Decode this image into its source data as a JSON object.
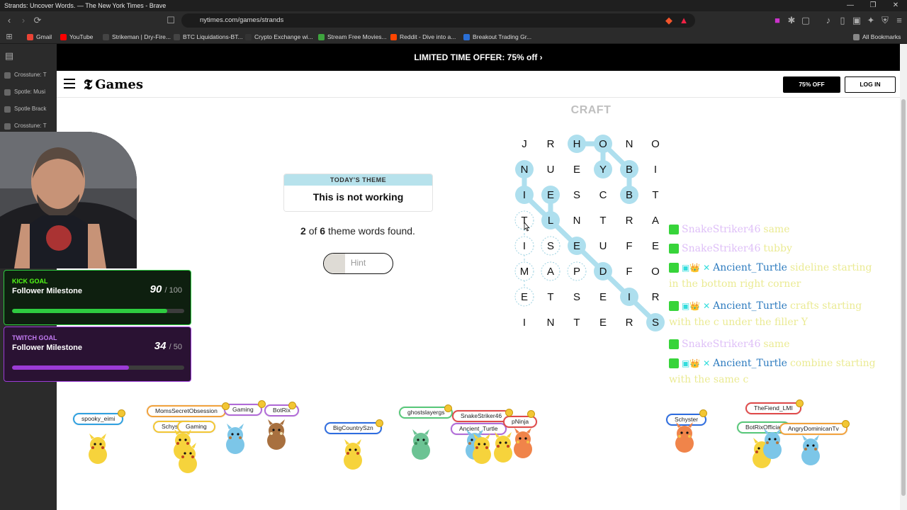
{
  "browser": {
    "window_title": "Strands: Uncover Words. — The New York Times - Brave",
    "url": "nytimes.com/games/strands",
    "bookmarks": [
      {
        "label": "Gmail",
        "color": "#ea4335"
      },
      {
        "label": "YouTube",
        "color": "#ff0000"
      },
      {
        "label": "Strikeman | Dry-Fire...",
        "color": "#444444"
      },
      {
        "label": "BTC Liquidations-BT...",
        "color": "#444444"
      },
      {
        "label": "Crypto Exchange wi...",
        "color": "#333333"
      },
      {
        "label": "Stream Free Movies...",
        "color": "#3ea43e"
      },
      {
        "label": "Reddit - Dive into a...",
        "color": "#ff4500"
      },
      {
        "label": "Breakout Trading Gr...",
        "color": "#2a6fd6"
      }
    ],
    "all_bookmarks": "All Bookmarks"
  },
  "sidebar": {
    "items": [
      "Crosstune: T",
      "Spotle: Musi",
      "Spotle Brack",
      "Crosstune: T"
    ]
  },
  "page": {
    "promo": "LIMITED TIME OFFER: 75% off ›",
    "logo": "Games",
    "offer_button": "75% OFF",
    "login_button": "LOG IN",
    "theme_label": "TODAY'S THEME",
    "theme_text": "This is not working",
    "progress": {
      "found": "2",
      "of_word": "of",
      "total": "6",
      "suffix": "theme words found."
    },
    "hint_label": "Hint",
    "found_word": "CRAFT"
  },
  "board": {
    "rows": [
      [
        "J",
        "R",
        "H",
        "O",
        "N",
        "O"
      ],
      [
        "N",
        "U",
        "E",
        "Y",
        "B",
        "I"
      ],
      [
        "I",
        "E",
        "S",
        "C",
        "B",
        "T"
      ],
      [
        "T",
        "L",
        "N",
        "T",
        "R",
        "A"
      ],
      [
        "I",
        "S",
        "E",
        "U",
        "F",
        "E"
      ],
      [
        "M",
        "A",
        "P",
        "D",
        "F",
        "O"
      ],
      [
        "E",
        "T",
        "S",
        "E",
        "I",
        "R"
      ],
      [
        "I",
        "N",
        "T",
        "E",
        "R",
        "S"
      ]
    ],
    "highlight_color": "#aedfee",
    "highlighted": [
      [
        0,
        2
      ],
      [
        0,
        3
      ],
      [
        1,
        0
      ],
      [
        1,
        3
      ],
      [
        1,
        4
      ],
      [
        2,
        0
      ],
      [
        2,
        1
      ],
      [
        2,
        4
      ],
      [
        3,
        1
      ],
      [
        4,
        2
      ],
      [
        5,
        3
      ],
      [
        6,
        4
      ],
      [
        7,
        5
      ]
    ],
    "dashed": [
      [
        3,
        0
      ],
      [
        4,
        0
      ],
      [
        4,
        1
      ],
      [
        5,
        0
      ],
      [
        5,
        1
      ],
      [
        5,
        2
      ],
      [
        6,
        0
      ]
    ]
  },
  "overlay": {
    "kick_goal": {
      "tag": "KICK GOAL",
      "name": "Follower Milestone",
      "current": "90",
      "target": "100",
      "fraction": 0.9,
      "color": "#2ecc40"
    },
    "twitch_goal": {
      "tag": "TWITCH GOAL",
      "name": "Follower Milestone",
      "current": "34",
      "target": "50",
      "fraction": 0.68,
      "color": "#9b3bd6"
    },
    "chat": [
      {
        "user": "SnakeStriker46",
        "msg": "same",
        "style": "faded"
      },
      {
        "user": "SnakeStriker46",
        "msg": "tubby",
        "style": "faded"
      },
      {
        "user": "Ancient_Turtle",
        "msg": "sideline starting",
        "style": "badged",
        "cont": "in the bottom right corner"
      },
      {
        "user": "Ancient_Turtle",
        "msg": "crafts starting",
        "style": "badged",
        "cont": "with the c under the filler Y"
      },
      {
        "user": "SnakeStriker46",
        "msg": "same",
        "style": "faded"
      },
      {
        "user": "Ancient_Turtle",
        "msg": "combine starting",
        "style": "badged",
        "cont": "with the same c"
      }
    ],
    "pokemon_tags": [
      "spooky_eimi",
      "MomsSecretObsession",
      "Gaming",
      "BotRix",
      "Schyster",
      "Gaming",
      "BigCountrySzn",
      "ghostslayergs",
      "SnakeStriker46",
      "Ancient_Turtle",
      "pNinja",
      "Schyster",
      "TheFiend_LMI",
      "BotRixOfficial",
      "AngryDominicanTv"
    ]
  }
}
